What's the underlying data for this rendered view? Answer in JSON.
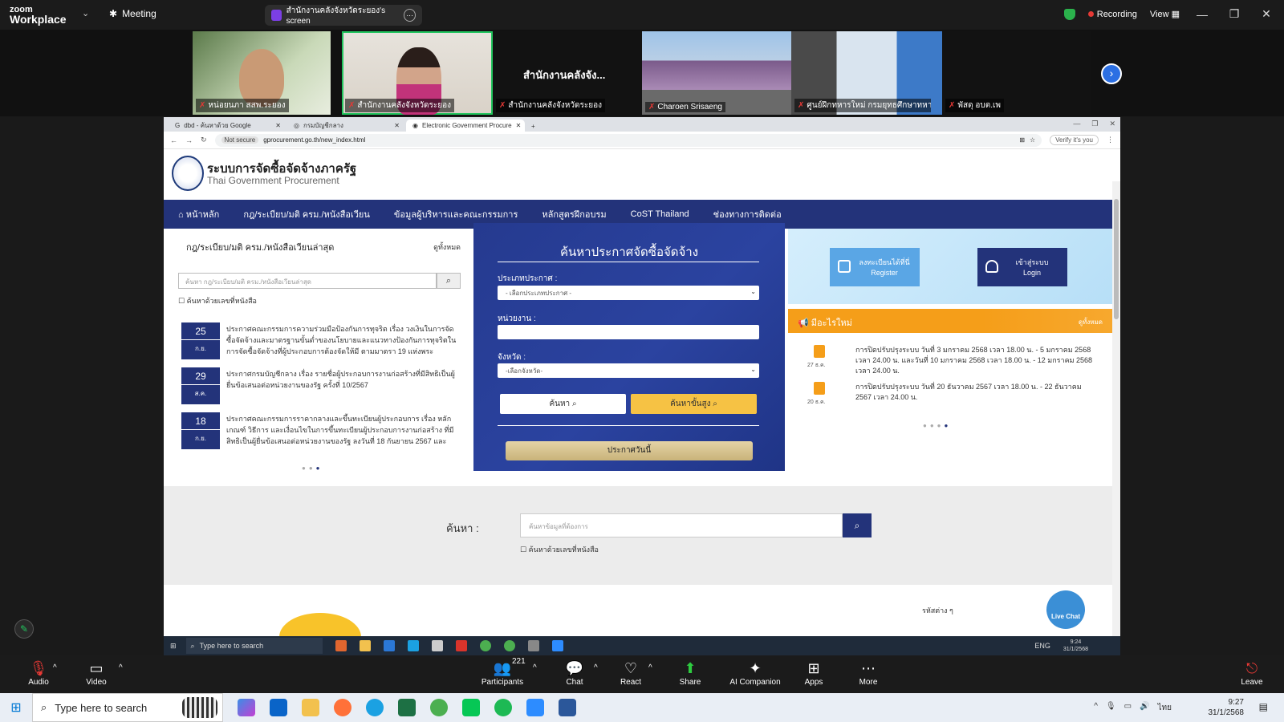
{
  "zoom": {
    "logo_line1": "zoom",
    "logo_line2": "Workplace",
    "meeting_label": "Meeting",
    "share_title": "สำนักงานคลังจังหวัดระยอง's screen",
    "recording_label": "Recording",
    "view_label": "View",
    "participants": [
      {
        "name": "หน่อยนภา สสพ.ระยอง"
      },
      {
        "name": "สำนักงานคลังจังหวัดระยอง"
      },
      {
        "name": "สำนักงานคลังจังหวัดระยอง",
        "overlay": "สำนักงานคลังจัง..."
      },
      {
        "name": "Charoen Srisaeng"
      },
      {
        "name": "ศูนย์ฝึกทหารใหม่ กรมยุทธศึกษาทหาร..."
      },
      {
        "name": "พัสดุ อบต.เพ"
      }
    ],
    "toolbar": {
      "audio": "Audio",
      "video": "Video",
      "participants": "Participants",
      "participants_count": "221",
      "chat": "Chat",
      "react": "React",
      "share": "Share",
      "ai": "AI Companion",
      "apps": "Apps",
      "more": "More",
      "leave": "Leave"
    }
  },
  "browser": {
    "tabs": [
      {
        "label": "dbd - ค้นหาด้วย Google"
      },
      {
        "label": "กรมบัญชีกลาง"
      },
      {
        "label": "Electronic Government Procure"
      }
    ],
    "not_secure": "Not secure",
    "url": "gprocurement.go.th/new_index.html",
    "verify": "Verify it's you"
  },
  "site": {
    "title": "ระบบการจัดซื้อจัดจ้างภาครัฐ",
    "subtitle": "Thai Government Procurement",
    "nav": [
      "หน้าหลัก",
      "กฎ/ระเบียบ/มติ ครม./หนังสือเวียน",
      "ข้อมูลผู้บริหารและคณะกรรมการ",
      "หลักสูตรฝึกอบรม",
      "CoST Thailand",
      "ช่องทางการติดต่อ"
    ],
    "left": {
      "heading": "กฎ/ระเบียบ/มติ ครม./หนังสือเวียนล่าสุด",
      "view_all": "ดูทั้งหมด",
      "search_placeholder": "ค้นหา กฎ/ระเบียบ/มติ ครม./หนังสือเวียนล่าสุด",
      "checkbox": "ค้นหาด้วยเลขที่หนังสือ",
      "items": [
        {
          "day": "25",
          "month": "ก.ย.",
          "text": "ประกาศคณะกรรมการความร่วมมือป้องกันการทุจริต เรื่อง วงเงินในการจัดซื้อจัดจ้างและมาตรฐานขั้นต่ำของนโยบายและแนวทางป้องกันการทุจริตในการจัดซื้อจัดจ้างที่ผู้ประกอบการต้องจัดให้มี ตามมาตรา 19 แห่งพระ"
        },
        {
          "day": "29",
          "month": "ส.ค.",
          "text": "ประกาศกรมบัญชีกลาง เรื่อง รายชื่อผู้ประกอบการงานก่อสร้างที่มีสิทธิเป็นผู้ยื่นข้อเสนอต่อหน่วยงานของรัฐ ครั้งที่ 10/2567"
        },
        {
          "day": "18",
          "month": "ก.ย.",
          "text": "ประกาศคณะกรรมการราคากลางและขึ้นทะเบียนผู้ประกอบการ เรื่อง หลักเกณฑ์ วิธีการ และเงื่อนไขในการขึ้นทะเบียนผู้ประกอบการงานก่อสร้าง ที่มีสิทธิเป็นผู้ยื่นข้อเสนอต่อหน่วยงานของรัฐ ลงวันที่ 18 กันยายน 2567 และ"
        }
      ]
    },
    "center": {
      "title": "ค้นหาประกาศจัดซื้อจัดจ้าง",
      "type_label": "ประเภทประกาศ :",
      "type_value": "- เลือกประเภทประกาศ -",
      "agency_label": "หน่วยงาน :",
      "agency_value": "",
      "province_label": "จังหวัด :",
      "province_value": "-เลือกจังหวัด-",
      "search_btn": "ค้นหา",
      "advanced_btn": "ค้นหาขั้นสูง",
      "today_btn": "ประกาศวันนี้"
    },
    "right": {
      "register_line1": "ลงทะเบียนได้ที่นี่",
      "register_line2": "Register",
      "login_line1": "เข้าสู่ระบบ",
      "login_line2": "Login",
      "news_title": "มีอะไรใหม่",
      "news_all": "ดูทั้งหมด",
      "news": [
        {
          "date": "27 ธ.ค.",
          "text": "การปิดปรับปรุงระบบ วันที่ 3 มกราคม 2568 เวลา 18.00 น. - 5 มกราคม 2568 เวลา 24.00 น. และวันที่ 10 มกราคม 2568 เวลา 18.00 น. - 12 มกราคม 2568 เวลา 24.00 น."
        },
        {
          "date": "20 ธ.ค.",
          "text": "การปิดปรับปรุงระบบ วันที่ 20 ธันวาคม 2567 เวลา 18.00 น. - 22 ธันวาคม 2567 เวลา 24.00 น."
        }
      ]
    },
    "bottom": {
      "search_label": "ค้นหา :",
      "search_placeholder": "ค้นหาข้อมูลที่ต้องการ",
      "checkbox": "ค้นหาด้วยเลขที่หนังสือ",
      "live_chat": "Live Chat",
      "codes_label": "รหัสต่าง ๆ"
    }
  },
  "inner_taskbar": {
    "search": "Type here to search",
    "lang": "ENG",
    "time": "9:24",
    "date": "31/1/2568"
  },
  "windows": {
    "search": "Type here to search",
    "lang": "ไทย",
    "time": "9:27",
    "date": "31/1/2568"
  }
}
